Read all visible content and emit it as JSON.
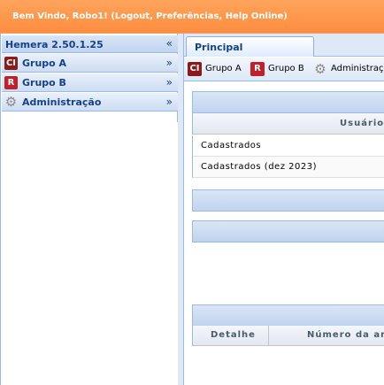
{
  "header": {
    "welcome_text": "Bem Vindo, Robo1! (Logout, Preferências, Help Online)"
  },
  "sidebar": {
    "title": "Hemera 2.50.1.25",
    "collapse_glyph": "«",
    "items": [
      {
        "label": "Grupo A",
        "icon": "ci-icon",
        "icon_text": "CI",
        "expand_glyph": "»"
      },
      {
        "label": "Grupo B",
        "icon": "r-icon",
        "icon_text": "R",
        "expand_glyph": "»"
      },
      {
        "label": "Administração",
        "icon": "gear-icon",
        "icon_text": "⚙",
        "expand_glyph": "»"
      }
    ]
  },
  "tabs": [
    {
      "label": "Principal",
      "active": true
    }
  ],
  "toolbar": {
    "buttons": [
      {
        "label": "Grupo A",
        "icon": "ci-icon",
        "icon_text": "CI"
      },
      {
        "label": "Grupo B",
        "icon": "r-icon",
        "icon_text": "R"
      },
      {
        "label": "Administração",
        "icon": "gear-icon",
        "icon_text": "⚙"
      }
    ]
  },
  "panels": {
    "usuarios": {
      "column_header": "Usuários",
      "rows": [
        {
          "label": "Cadastrados"
        },
        {
          "label": "Cadastrados (dez 2023)"
        }
      ]
    },
    "table": {
      "columns": [
        "Detalhe",
        "Número da an"
      ]
    }
  },
  "colors": {
    "header_orange": "#fd8d3f",
    "panel_blue": "#c0d3ee",
    "title_text": "#15428b",
    "border": "#99bbe8"
  }
}
